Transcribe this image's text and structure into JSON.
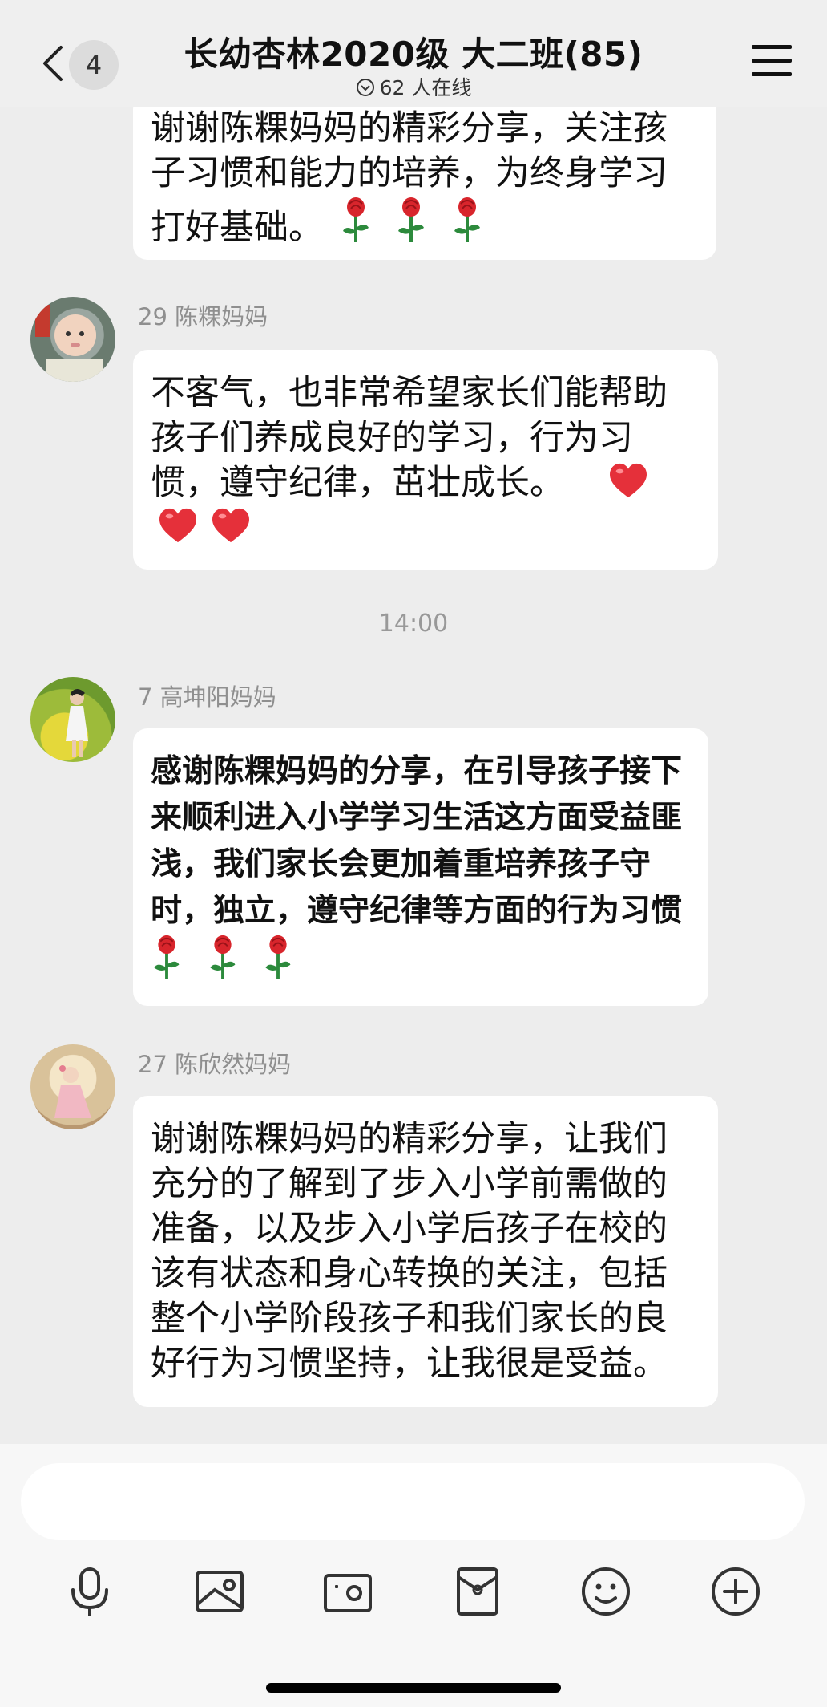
{
  "header": {
    "badge": "4",
    "title": "长幼杏林2020级 大二班(85)",
    "online": "62 人在线"
  },
  "messages": [
    {
      "sender": "",
      "text": "谢谢陈粿妈妈的精彩分享，关注孩子习惯和能力的培养，为终身学习打好基础。",
      "emoji": "rose x3"
    },
    {
      "sender": "29 陈粿妈妈",
      "text": "不客气，也非常希望家长们能帮助孩子们养成良好的学习，行为习惯，遵守纪律，茁壮成长。",
      "emoji": "heart x3"
    },
    {
      "sender": "7 高坤阳妈妈",
      "text": "感谢陈粿妈妈的分享，在引导孩子接下来顺利进入小学学习生活这方面受益匪浅，我们家长会更加着重培养孩子守时，独立，遵守纪律等方面的行为习惯",
      "emoji": "rose x3"
    },
    {
      "sender": "27 陈欣然妈妈",
      "text": "谢谢陈粿妈妈的精彩分享，让我们充分的了解到了步入小学前需做的准备，以及步入小学后孩子在校的该有状态和身心转换的关注，包括整个小学阶段孩子和我们家长的良好行为习惯坚持，让我很是受益。",
      "emoji": ""
    }
  ],
  "timestamp": "14:00",
  "input": {
    "placeholder": ""
  },
  "toolbar": [
    "mic-icon",
    "image-icon",
    "camera-icon",
    "red-packet-icon",
    "emoji-icon",
    "plus-icon"
  ],
  "colors": {
    "background": "#ededed",
    "bubble": "#ffffff",
    "rose": "#d8252c",
    "stem": "#2c8a3c",
    "heart": "#e5303a"
  }
}
